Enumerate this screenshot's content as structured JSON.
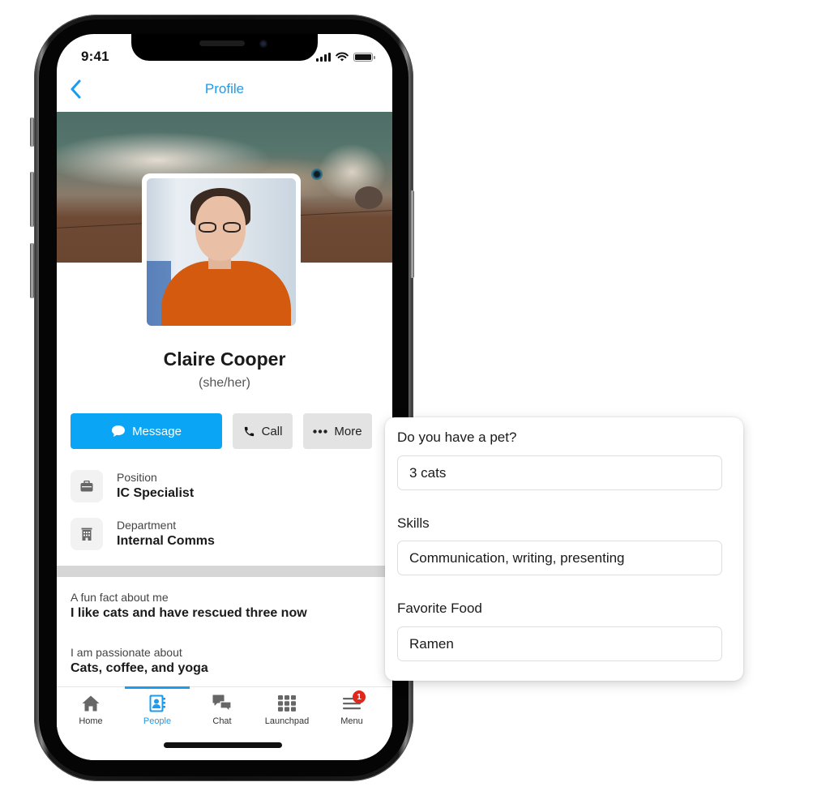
{
  "status_bar": {
    "time": "9:41"
  },
  "nav": {
    "title": "Profile",
    "back_icon": "chevron-left-icon"
  },
  "profile": {
    "name": "Claire Cooper",
    "pronouns": "(she/her)"
  },
  "actions": {
    "message_label": "Message",
    "call_label": "Call",
    "more_label": "More"
  },
  "details": [
    {
      "label": "Position",
      "value": "IC Specialist",
      "icon": "briefcase-icon"
    },
    {
      "label": "Department",
      "value": "Internal Comms",
      "icon": "building-icon"
    }
  ],
  "facts": [
    {
      "label": "A fun fact about me",
      "value": "I like cats and have rescued three now"
    },
    {
      "label": "I am passionate about",
      "value": "Cats, coffee, and yoga"
    }
  ],
  "tabs": [
    {
      "label": "Home",
      "icon": "home-icon",
      "active": false
    },
    {
      "label": "People",
      "icon": "contacts-book-icon",
      "active": true
    },
    {
      "label": "Chat",
      "icon": "chat-bubbles-icon",
      "active": false
    },
    {
      "label": "Launchpad",
      "icon": "grid-icon",
      "active": false
    },
    {
      "label": "Menu",
      "icon": "hamburger-menu-icon",
      "active": false,
      "badge": "1"
    }
  ],
  "card": {
    "fields": [
      {
        "label": "Do you have a pet?",
        "value": "3 cats"
      },
      {
        "label": "Skills",
        "value": "Communication, writing, presenting"
      },
      {
        "label": "Favorite Food",
        "value": "Ramen"
      }
    ]
  },
  "colors": {
    "accent": "#1a9cf0",
    "primary_button": "#0ba5f5",
    "secondary_button": "#e3e3e3",
    "badge": "#e0271b"
  }
}
